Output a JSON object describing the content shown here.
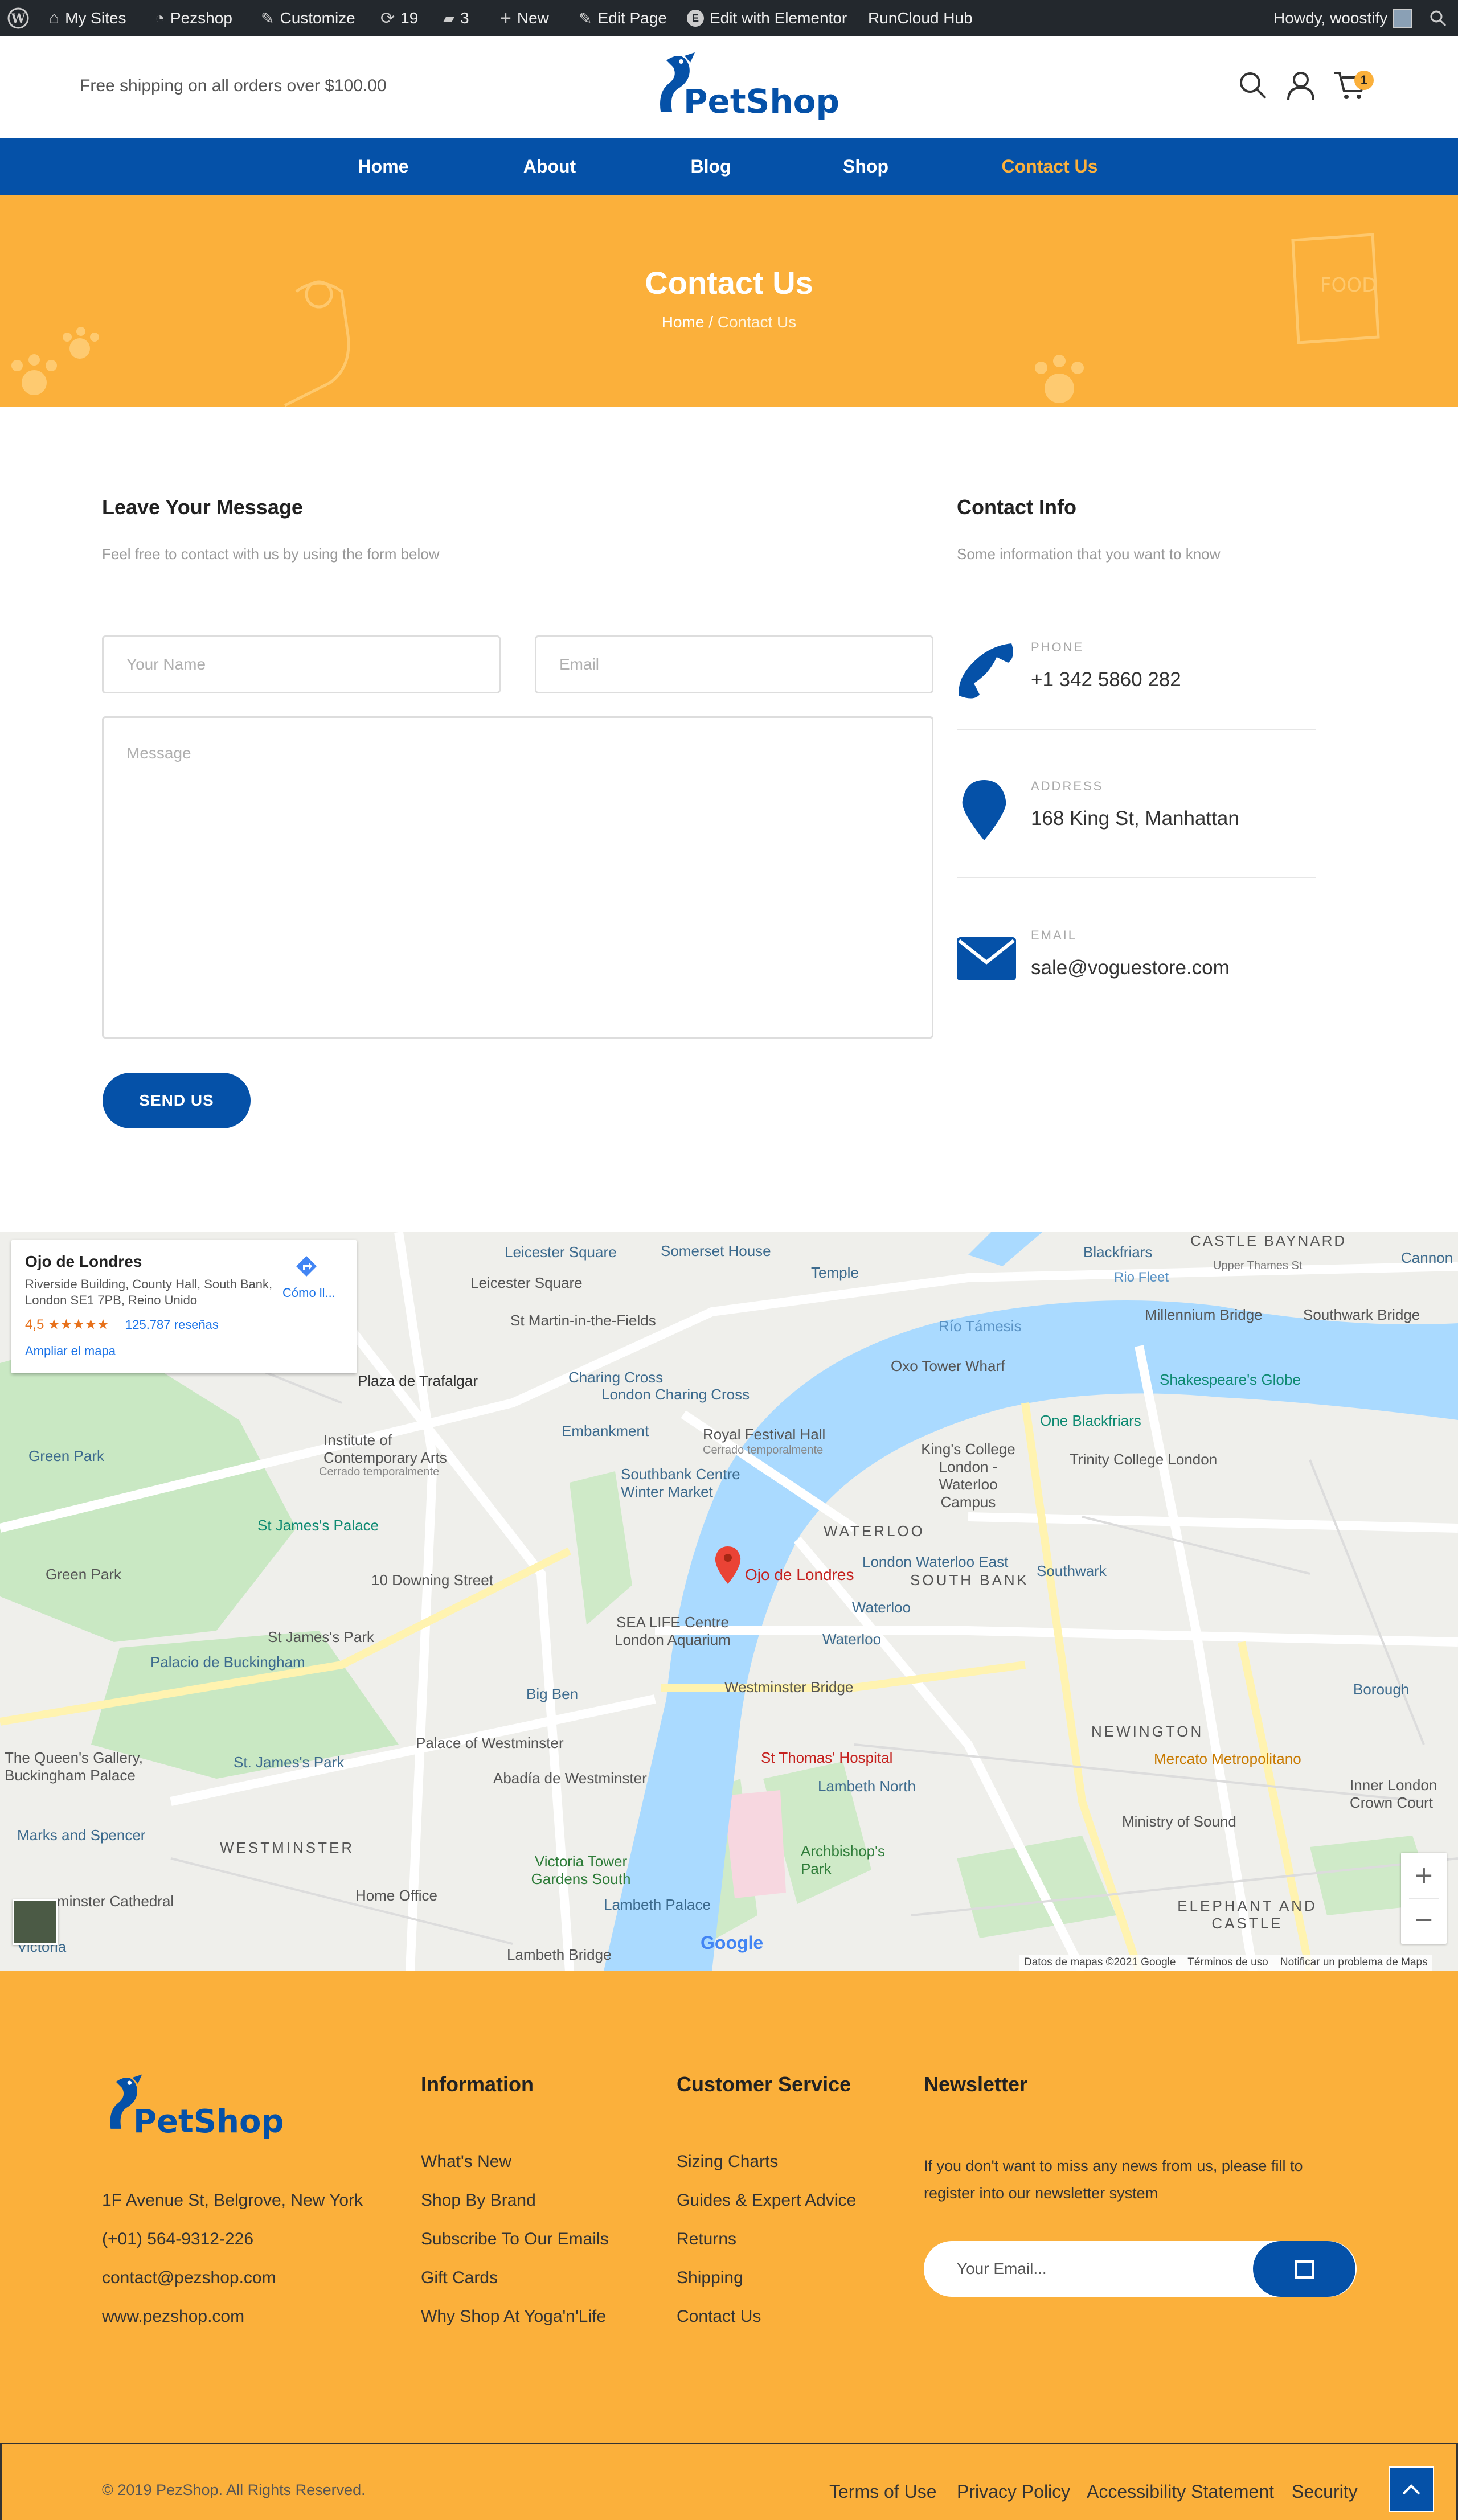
{
  "adminbar": {
    "my_sites": "My Sites",
    "site_name": "Pezshop",
    "customize": "Customize",
    "updates": "19",
    "comments": "3",
    "new": "New",
    "edit_page": "Edit Page",
    "edit_elementor": "Edit with Elementor",
    "runcloud": "RunCloud Hub",
    "howdy": "Howdy, woostify"
  },
  "header": {
    "shipping_text": "Free shipping on all orders over $100.00",
    "logo_text": "PetShop",
    "cart_count": "1"
  },
  "nav": {
    "items": [
      "Home",
      "About",
      "Blog",
      "Shop",
      "Contact Us"
    ],
    "active_color": "#fbb03b"
  },
  "banner": {
    "title": "Contact Us",
    "breadcrumb_home": "Home",
    "breadcrumb_sep": "/",
    "breadcrumb_current": "Contact Us"
  },
  "form": {
    "heading": "Leave Your Message",
    "subtext": "Feel free to contact with us by using the form below",
    "name_placeholder": "Your Name",
    "email_placeholder": "Email",
    "message_placeholder": "Message",
    "submit_label": "SEND US"
  },
  "contact": {
    "heading": "Contact Info",
    "subtext": "Some information that you want to know",
    "phone_label": "PHONE",
    "phone_value": "+1 342 5860 282",
    "address_label": "ADDRESS",
    "address_value": "168 King St, Manhattan",
    "email_label": "EMAIL",
    "email_value": "sale@voguestore.com"
  },
  "map": {
    "card_title": "Ojo de Londres",
    "card_address": "Riverside Building, County Hall, South Bank, London SE1 7PB, Reino Unido",
    "card_rating": "4,5",
    "card_stars": "★★★★★",
    "card_reviews": "125.787 reseñas",
    "card_directions": "Cómo ll...",
    "card_enlarge": "Ampliar el mapa",
    "labels": {
      "leicester_square": "Leicester Square",
      "somerset_house": "Somerset House",
      "temple": "Temple",
      "blackfriars": "Blackfriars",
      "castle_baynard": "CASTLE BAYNARD",
      "cannon": "Cannon",
      "rio_fleet": "Rio Fleet",
      "upper_thames": "Upper Thames St",
      "millennium_bridge": "Millennium Bridge",
      "southwark_bridge": "Southwark Bridge",
      "st_martin": "St Martin-in-the-Fields",
      "rio_tamesis": "Río Támesis",
      "plaza_trafalgar": "Plaza de Trafalgar",
      "charing_cross": "Charing Cross",
      "london_charing_cross": "London Charing Cross",
      "oxo_tower": "Oxo Tower Wharf",
      "shakespeare": "Shakespeare's Globe",
      "embankment": "Embankment",
      "royal_festival": "Royal Festival Hall",
      "temp_closed": "Cerrado temporalmente",
      "one_blackfriars": "One Blackfriars",
      "green_park": "Green Park",
      "ica": "Institute of Contemporary Arts",
      "kings_college": "King's College London - Waterloo Campus",
      "trinity": "Trinity College London",
      "southbank_centre": "Southbank Centre Winter Market",
      "st_james_palace": "St James's Palace",
      "waterloo": "WATERLOO",
      "london_waterloo_east": "London Waterloo East",
      "southwark": "Southwark",
      "south_bank": "SOUTH BANK",
      "ojo_pin": "Ojo de Londres",
      "downing": "10 Downing Street",
      "waterloo_st": "Waterloo",
      "sea_life": "SEA LIFE Centre London Aquarium",
      "st_james_park": "St James's Park",
      "palacio_buckingham": "Palacio de Buckingham",
      "big_ben": "Big Ben",
      "westminster_bridge": "Westminster Bridge",
      "borough": "Borough",
      "newington": "NEWINGTON",
      "palace_westminster": "Palace of Westminster",
      "st_thomas": "St Thomas' Hospital",
      "mercato": "Mercato Metropolitano",
      "queens_gallery": "The Queen's Gallery, Buckingham Palace",
      "st_james_park_st": "St. James's Park",
      "abadia": "Abadía de Westminster",
      "lambeth_north": "Lambeth North",
      "inner_london": "Inner London Crown Court",
      "marks_spencer": "Marks and Spencer",
      "westminster": "WESTMINSTER",
      "archbishops_park": "Archbishop's Park",
      "ministry_sound": "Ministry of Sound",
      "victoria_tower": "Victoria Tower Gardens South",
      "home_office": "Home Office",
      "elephant": "ELEPHANT AND CASTLE",
      "westminster_cathedral": "minster Cathedral",
      "lambeth_palace": "Lambeth Palace",
      "lambeth_bridge": "Lambeth Bridge",
      "victoria": "Victoria"
    },
    "attribution": "Datos de mapas ©2021 Google",
    "terms": "Términos de uso",
    "report": "Notificar un problema de Maps",
    "google": "Google"
  },
  "footer": {
    "logo_text": "PetShop",
    "address": "1F Avenue St, Belgrove, New York",
    "phone": "(+01) 564-9312-226",
    "email": "contact@pezshop.com",
    "website": "www.pezshop.com",
    "info_heading": "Information",
    "info_links": [
      "What's New",
      "Shop By Brand",
      "Subscribe To Our Emails",
      "Gift Cards",
      "Why Shop At Yoga'n'Life"
    ],
    "cs_heading": "Customer Service",
    "cs_links": [
      "Sizing Charts",
      "Guides & Expert Advice",
      "Returns",
      "Shipping",
      "Contact Us"
    ],
    "newsletter_heading": "Newsletter",
    "newsletter_text": "If you don't want to miss any news from us, please fill to register into our newsletter system",
    "newsletter_placeholder": "Your Email...",
    "copyright": "© 2019 PezShop. All Rights Reserved.",
    "bottom_links": [
      "Terms of Use",
      "Privacy Policy",
      "Accessibility Statement",
      "Security"
    ]
  },
  "colors": {
    "brand_blue": "#0551a8",
    "brand_orange": "#fbb03b",
    "admin_bar": "#23282d"
  }
}
